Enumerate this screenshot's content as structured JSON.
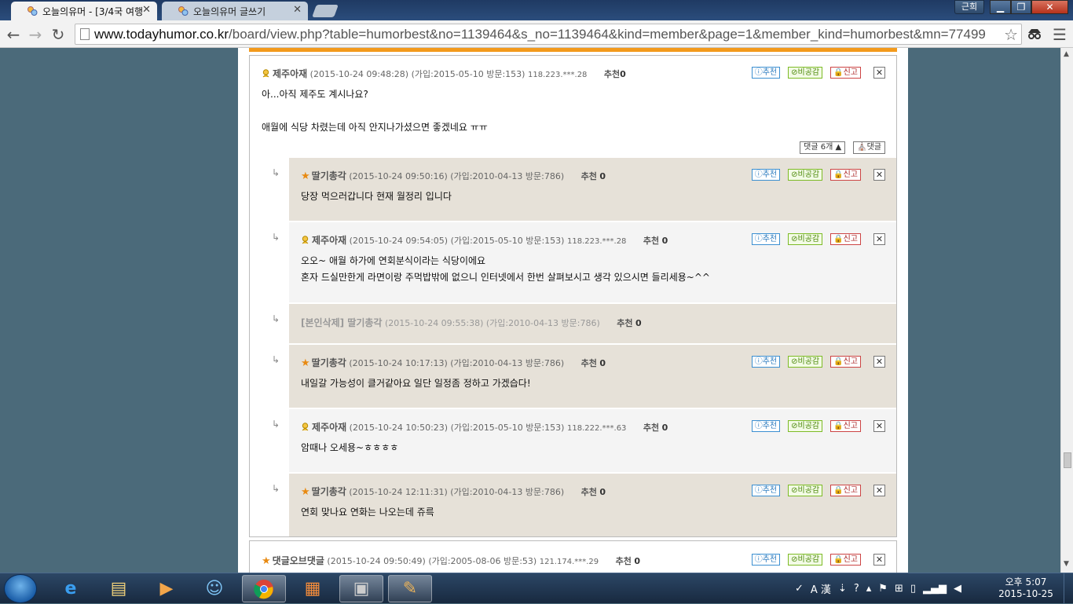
{
  "browser": {
    "tabs": [
      {
        "title": "오늘의유머 - [3/4국 여행"
      },
      {
        "title": "오늘의유머 글쓰기"
      }
    ],
    "user_badge": "근희",
    "window_buttons": {
      "minimize": "▁",
      "maximize": "❐",
      "close": "✕"
    },
    "url_domain": "www.todayhumor.co.kr",
    "url_path": "/board/view.php?table=humorbest&no=1139464&s_no=1139464&kind=member&page=1&member_kind=humorbest&mn=77499"
  },
  "thread": {
    "top": {
      "nick": "제주아재",
      "meta": "(2015-10-24 09:48:28) (가입:2015-05-10 방문:153)",
      "ip": "118.223.***.28",
      "rec_label": "추천",
      "rec_count": "0",
      "lines": [
        "아...아직 제주도 계시나요?",
        "",
        "애월에 식당 차렸는데 아직 안지나가셨으면 좋겠네요 ㅠㅠ"
      ],
      "replies_btn": "댓글 6개 ▲",
      "reply_btn": "댓글"
    },
    "buttons": {
      "recommend": "추천",
      "unlike": "비공감",
      "report": "신고",
      "close": "✕"
    },
    "replies": [
      {
        "nick": "딸기총각",
        "meta": "(2015-10-24 09:50:16) (가입:2010-04-13 방문:786)",
        "ip": "",
        "rec_label": "추천",
        "rec_count": "0",
        "lines": [
          "당장 먹으러갑니다 현재 월정리 입니다"
        ]
      },
      {
        "nick": "제주아재",
        "meta": "(2015-10-24 09:54:05) (가입:2015-05-10 방문:153)",
        "ip": "118.223.***.28",
        "rec_label": "추천",
        "rec_count": "0",
        "lines": [
          "오오~ 애월 하가에 연회분식이라는 식당이에요",
          "혼자 드실만한게 라면이랑 주먹밥밖에 없으니 인터넷에서 한번 살펴보시고 생각 있으시면 들리세용~^^"
        ]
      },
      {
        "deleted": "[본인삭제] 딸기총각",
        "meta": "(2015-10-24 09:55:38) (가입:2010-04-13 방문:786)",
        "rec_label": "추천",
        "rec_count": "0"
      },
      {
        "nick": "딸기총각",
        "meta": "(2015-10-24 10:17:13) (가입:2010-04-13 방문:786)",
        "ip": "",
        "rec_label": "추천",
        "rec_count": "0",
        "lines": [
          "내일갈 가능성이 클거같아요 일단 일정좀 정하고 가겠습다!"
        ]
      },
      {
        "nick": "제주아재",
        "meta": "(2015-10-24 10:50:23) (가입:2015-05-10 방문:153)",
        "ip": "118.222.***.63",
        "rec_label": "추천",
        "rec_count": "0",
        "lines": [
          "암때나 오세용~ㅎㅎㅎㅎ"
        ]
      },
      {
        "nick": "딸기총각",
        "meta": "(2015-10-24 12:11:31) (가입:2010-04-13 방문:786)",
        "ip": "",
        "rec_label": "추천",
        "rec_count": "0",
        "lines": [
          "연회 맞나요 연화는 나오는데 쥬륵"
        ]
      }
    ],
    "next": {
      "nick": "댓글오브댓글",
      "meta": "(2015-10-24 09:50:49) (가입:2005-08-06 방문:53)",
      "ip": "121.174.***.29",
      "rec_label": "추천",
      "rec_count": "0"
    }
  },
  "taskbar": {
    "ime": "A 漢",
    "clock_time": "오후 5:07",
    "clock_date": "2015-10-25"
  },
  "colors": {
    "accent": "#f39a1c",
    "beige": "#e6e1d8",
    "light": "#f4f4f4"
  }
}
